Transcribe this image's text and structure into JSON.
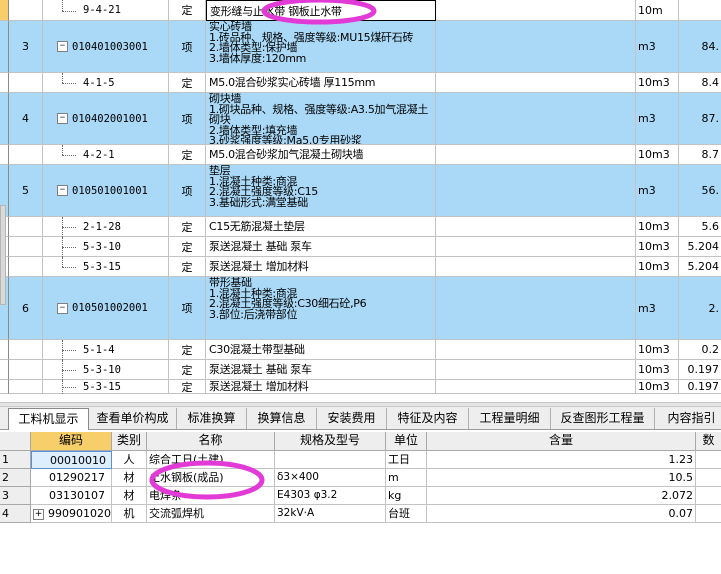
{
  "upper_grid": {
    "rows": [
      {
        "num": "",
        "code": "9-4-21",
        "type": "定",
        "name": "变形缝与止水带 钢板止水带",
        "unit": "10m",
        "qty": "",
        "kind": "sub"
      },
      {
        "num": "3",
        "code": "010401003001",
        "type": "项",
        "name": "实心砖墙\n1.砖品种、规格、强度等级:MU15煤矸石砖\n2.墙体类型:保护墙\n3.墙体厚度:120mm",
        "unit": "m3",
        "qty": "84.",
        "kind": "item"
      },
      {
        "num": "",
        "code": "4-1-5",
        "type": "定",
        "name": "M5.0混合砂浆实心砖墙 厚115mm",
        "unit": "10m3",
        "qty": "8.4",
        "kind": "sub"
      },
      {
        "num": "4",
        "code": "010402001001",
        "type": "项",
        "name": "砌块墙\n1.砌块品种、规格、强度等级:A3.5加气混凝土砌块\n2.墙体类型:填充墙\n3.砂浆强度等级:Ma5.0专用砂浆",
        "unit": "m3",
        "qty": "87.",
        "kind": "item"
      },
      {
        "num": "",
        "code": "4-2-1",
        "type": "定",
        "name": "M5.0混合砂浆加气混凝土砌块墙",
        "unit": "10m3",
        "qty": "8.7",
        "kind": "sub"
      },
      {
        "num": "5",
        "code": "010501001001",
        "type": "项",
        "name": "垫层\n1.混凝土种类:商混\n2.混凝土强度等级:C15\n3.基础形式:满堂基础",
        "unit": "m3",
        "qty": "56.",
        "kind": "item"
      },
      {
        "num": "",
        "code": "2-1-28",
        "type": "定",
        "name": "C15无筋混凝土垫层",
        "unit": "10m3",
        "qty": "5.6",
        "kind": "sub"
      },
      {
        "num": "",
        "code": "5-3-10",
        "type": "定",
        "name": "泵送混凝土 基础 泵车",
        "unit": "10m3",
        "qty": "5.204",
        "kind": "sub"
      },
      {
        "num": "",
        "code": "5-3-15",
        "type": "定",
        "name": "泵送混凝土 增加材料",
        "unit": "10m3",
        "qty": "5.204",
        "kind": "sub"
      },
      {
        "num": "6",
        "code": "010501002001",
        "type": "项",
        "name": "带形基础\n1.混凝土种类:商混\n2.混凝土强度等级:C30细石砼,P6\n3.部位:后浇带部位",
        "unit": "m3",
        "qty": "2.",
        "kind": "item"
      },
      {
        "num": "",
        "code": "5-1-4",
        "type": "定",
        "name": "C30混凝土带型基础",
        "unit": "10m3",
        "qty": "0.2",
        "kind": "sub"
      },
      {
        "num": "",
        "code": "5-3-10",
        "type": "定",
        "name": "泵送混凝土 基础 泵车",
        "unit": "10m3",
        "qty": "0.197",
        "kind": "sub"
      },
      {
        "num": "",
        "code": "5-3-15",
        "type": "定",
        "name": "泵送混凝土 增加材料",
        "unit": "10m3",
        "qty": "0.197",
        "kind": "sub"
      }
    ]
  },
  "tabs": [
    "工料机显示",
    "查看单价构成",
    "标准换算",
    "换算信息",
    "安装费用",
    "特征及内容",
    "工程量明细",
    "反查图形工程量",
    "内容指引"
  ],
  "lower_grid": {
    "headers": {
      "code": "编码",
      "cat": "类别",
      "name": "名称",
      "spec": "规格及型号",
      "unit": "单位",
      "qty": "含量",
      "more": "数"
    },
    "rows": [
      {
        "idx": "1",
        "code": "00010010",
        "cat": "人",
        "name": "综合工日(土建)",
        "spec": "",
        "unit": "工日",
        "qty": "1.23"
      },
      {
        "idx": "2",
        "code": "01290217",
        "cat": "材",
        "name": "止水钢板(成品)",
        "spec": "δ3×400",
        "unit": "m",
        "qty": "10.5"
      },
      {
        "idx": "3",
        "code": "03130107",
        "cat": "材",
        "name": "电焊条",
        "spec": "E4303 φ3.2",
        "unit": "kg",
        "qty": "2.072"
      },
      {
        "idx": "4",
        "code": "990901020",
        "cat": "机",
        "name": "交流弧焊机",
        "spec": "32kV·A",
        "unit": "台班",
        "qty": "0.07"
      }
    ]
  },
  "colors": {
    "selected_row": "#a9d9f7",
    "highlight_ellipse": "#e23ad6",
    "header_code": "#f7cf6a"
  }
}
